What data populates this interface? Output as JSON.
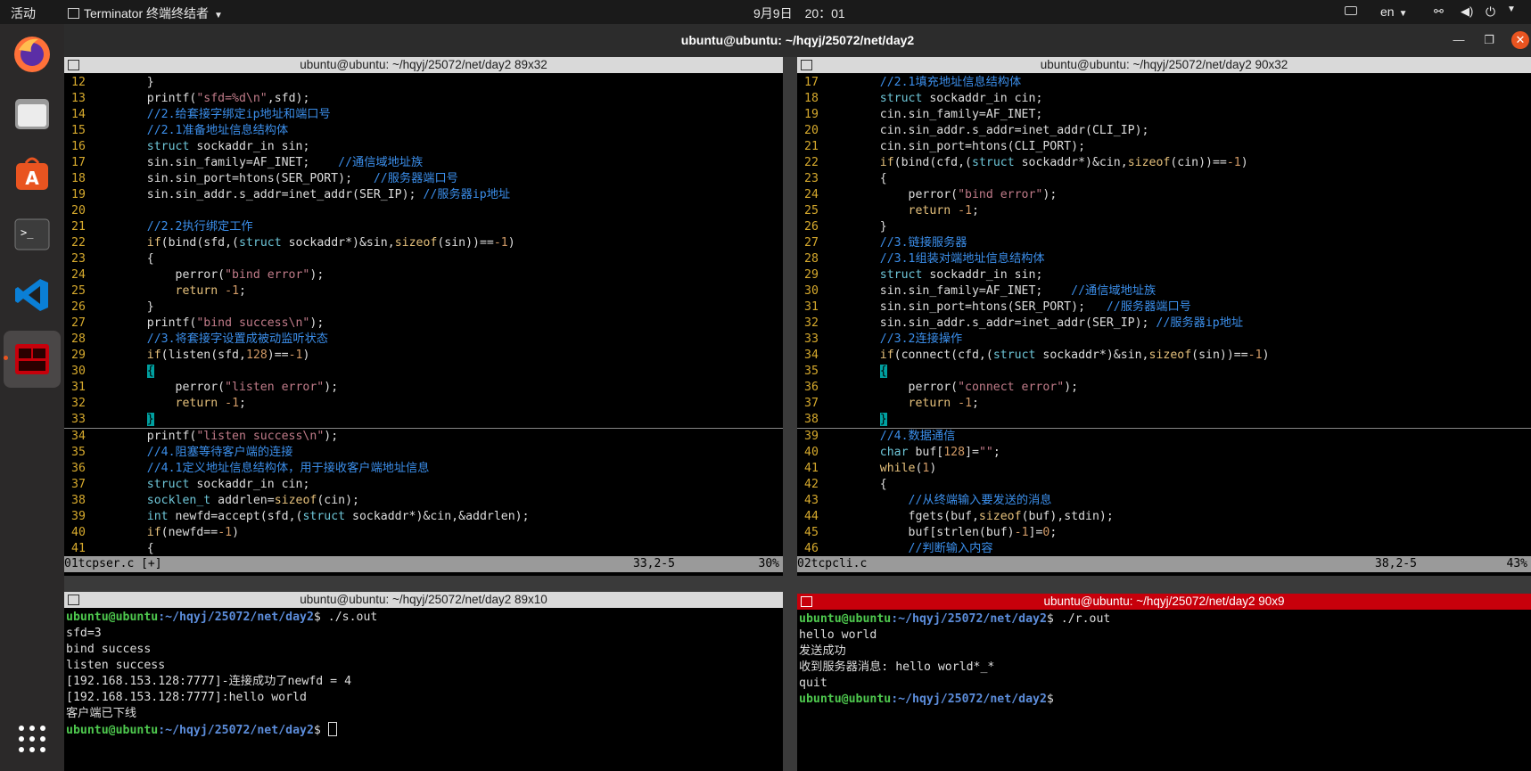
{
  "topbar": {
    "activities": "活动",
    "app_name": "Terminator 终端终结者",
    "clock": "9月9日　20：01",
    "lang": "en"
  },
  "window": {
    "title": "ubuntu@ubuntu: ~/hqyj/25072/net/day2"
  },
  "panes": {
    "tl": {
      "title": "ubuntu@ubuntu: ~/hqyj/25072/net/day2 89x32",
      "status_file": "01tcpser.c [+]",
      "status_pos": "33,2-5",
      "status_pct": "30%",
      "cursor_line": "33"
    },
    "tr": {
      "title": "ubuntu@ubuntu: ~/hqyj/25072/net/day2 90x32",
      "status_file": "02tcpcli.c",
      "status_pos": "38,2-5",
      "status_pct": "43%",
      "cursor_line": "38"
    },
    "bl": {
      "title": "ubuntu@ubuntu: ~/hqyj/25072/net/day2 89x10"
    },
    "br": {
      "title": "ubuntu@ubuntu: ~/hqyj/25072/net/day2 90x9"
    }
  },
  "code_left": [
    {
      "n": "12",
      "t": "    }"
    },
    {
      "n": "13",
      "t": "    printf(\"sfd=%d\\n\",sfd);"
    },
    {
      "n": "14",
      "t": "    //2.给套接字绑定ip地址和端口号"
    },
    {
      "n": "15",
      "t": "    //2.1准备地址信息结构体"
    },
    {
      "n": "16",
      "t": "    struct sockaddr_in sin;"
    },
    {
      "n": "17",
      "t": "    sin.sin_family=AF_INET;    //通信域地址族"
    },
    {
      "n": "18",
      "t": "    sin.sin_port=htons(SER_PORT);   //服务器端口号"
    },
    {
      "n": "19",
      "t": "    sin.sin_addr.s_addr=inet_addr(SER_IP); //服务器ip地址"
    },
    {
      "n": "20",
      "t": ""
    },
    {
      "n": "21",
      "t": "    //2.2执行绑定工作"
    },
    {
      "n": "22",
      "t": "    if(bind(sfd,(struct sockaddr*)&sin,sizeof(sin))==-1)"
    },
    {
      "n": "23",
      "t": "    {"
    },
    {
      "n": "24",
      "t": "        perror(\"bind error\");"
    },
    {
      "n": "25",
      "t": "        return -1;"
    },
    {
      "n": "26",
      "t": "    }"
    },
    {
      "n": "27",
      "t": "    printf(\"bind success\\n\");"
    },
    {
      "n": "28",
      "t": "    //3.将套接字设置成被动监听状态"
    },
    {
      "n": "29",
      "t": "    if(listen(sfd,128)==-1)"
    },
    {
      "n": "30",
      "t": "    {"
    },
    {
      "n": "31",
      "t": "        perror(\"listen error\");"
    },
    {
      "n": "32",
      "t": "        return -1;"
    },
    {
      "n": "33",
      "t": "    }"
    },
    {
      "n": "34",
      "t": "    printf(\"listen success\\n\");"
    },
    {
      "n": "35",
      "t": "    //4.阻塞等待客户端的连接"
    },
    {
      "n": "36",
      "t": "    //4.1定义地址信息结构体，用于接收客户端地址信息"
    },
    {
      "n": "37",
      "t": "    struct sockaddr_in cin;"
    },
    {
      "n": "38",
      "t": "    socklen_t addrlen=sizeof(cin);"
    },
    {
      "n": "39",
      "t": "    int newfd=accept(sfd,(struct sockaddr*)&cin,&addrlen);"
    },
    {
      "n": "40",
      "t": "    if(newfd==-1)"
    },
    {
      "n": "41",
      "t": "    {"
    }
  ],
  "code_right": [
    {
      "n": "17",
      "t": "    //2.1填充地址信息结构体"
    },
    {
      "n": "18",
      "t": "    struct sockaddr_in cin;"
    },
    {
      "n": "19",
      "t": "    cin.sin_family=AF_INET;"
    },
    {
      "n": "20",
      "t": "    cin.sin_addr.s_addr=inet_addr(CLI_IP);"
    },
    {
      "n": "21",
      "t": "    cin.sin_port=htons(CLI_PORT);"
    },
    {
      "n": "22",
      "t": "    if(bind(cfd,(struct sockaddr*)&cin,sizeof(cin))==-1)"
    },
    {
      "n": "23",
      "t": "    {"
    },
    {
      "n": "24",
      "t": "        perror(\"bind error\");"
    },
    {
      "n": "25",
      "t": "        return -1;"
    },
    {
      "n": "26",
      "t": "    }"
    },
    {
      "n": "27",
      "t": "    //3.链接服务器"
    },
    {
      "n": "28",
      "t": "    //3.1组装对端地址信息结构体"
    },
    {
      "n": "29",
      "t": "    struct sockaddr_in sin;"
    },
    {
      "n": "30",
      "t": "    sin.sin_family=AF_INET;    //通信域地址族"
    },
    {
      "n": "31",
      "t": "    sin.sin_port=htons(SER_PORT);   //服务器端口号"
    },
    {
      "n": "32",
      "t": "    sin.sin_addr.s_addr=inet_addr(SER_IP); //服务器ip地址"
    },
    {
      "n": "33",
      "t": "    //3.2连接操作"
    },
    {
      "n": "34",
      "t": "    if(connect(cfd,(struct sockaddr*)&sin,sizeof(sin))==-1)"
    },
    {
      "n": "35",
      "t": "    {"
    },
    {
      "n": "36",
      "t": "        perror(\"connect error\");"
    },
    {
      "n": "37",
      "t": "        return -1;"
    },
    {
      "n": "38",
      "t": "    }"
    },
    {
      "n": "39",
      "t": "    //4.数据通信"
    },
    {
      "n": "40",
      "t": "    char buf[128]=\"\";"
    },
    {
      "n": "41",
      "t": "    while(1)"
    },
    {
      "n": "42",
      "t": "    {"
    },
    {
      "n": "43",
      "t": "        //从终端输入要发送的消息"
    },
    {
      "n": "44",
      "t": "        fgets(buf,sizeof(buf),stdin);"
    },
    {
      "n": "45",
      "t": "        buf[strlen(buf)-1]=0;"
    },
    {
      "n": "46",
      "t": "        //判断输入内容"
    }
  ],
  "term_left": [
    {
      "p": true,
      "cmd": " ./s.out"
    },
    {
      "t": "sfd=3"
    },
    {
      "t": "bind success"
    },
    {
      "t": "listen success"
    },
    {
      "t": "[192.168.153.128:7777]-连接成功了newfd = 4"
    },
    {
      "t": "[192.168.153.128:7777]:hello world"
    },
    {
      "t": "客户端已下线"
    },
    {
      "p": true,
      "cmd": " ",
      "cursor": true
    }
  ],
  "term_right": [
    {
      "p": true,
      "cmd": " ./r.out"
    },
    {
      "t": "hello world"
    },
    {
      "t": "发送成功"
    },
    {
      "t": "收到服务器消息: hello world*_*"
    },
    {
      "t": "quit"
    },
    {
      "p": true,
      "cmd": ""
    }
  ],
  "prompt": {
    "user": "ubuntu@ubuntu",
    "path": ":~/hqyj/25072/net/day2",
    "sym": "$"
  },
  "dock": [
    {
      "name": "firefox-icon",
      "color": "#e66000"
    },
    {
      "name": "files-icon",
      "color": "#8a8a8a"
    },
    {
      "name": "software-center-icon",
      "color": "#e95420"
    },
    {
      "name": "terminal-icon",
      "color": "#3c3c3c"
    },
    {
      "name": "vscode-icon",
      "color": "#0078d4"
    },
    {
      "name": "terminator-icon",
      "color": "#c7000b"
    },
    {
      "name": "show-apps-icon",
      "color": "#ffffff"
    }
  ],
  "colors": {
    "accent_red": "#c7000b",
    "prompt_green": "#4ec94e",
    "prompt_blue": "#5c8ddb",
    "comment": "#3b8eea",
    "line_number": "#d7aa2d"
  }
}
